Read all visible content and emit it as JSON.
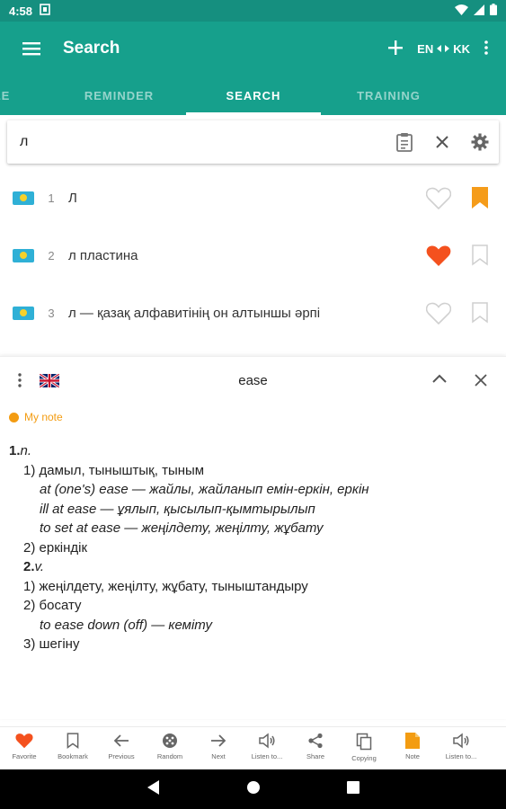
{
  "status": {
    "time": "4:58"
  },
  "appbar": {
    "title": "Search",
    "lang_from": "EN",
    "lang_to": "KK"
  },
  "tabs": [
    "LE",
    "REMINDER",
    "SEARCH",
    "TRAINING"
  ],
  "search": {
    "value": "л"
  },
  "results": [
    {
      "num": "1",
      "word": "Л",
      "favorite": false,
      "bookmarked": true
    },
    {
      "num": "2",
      "word": "л пластина",
      "favorite": true,
      "bookmarked": false
    },
    {
      "num": "3",
      "word": "л — қазақ алфавитінің он алтыншы әрпі",
      "favorite": false,
      "bookmarked": false
    }
  ],
  "panel": {
    "headword": "ease",
    "my_note": "My note",
    "article": {
      "pos1_num": "1.",
      "pos1": "n.",
      "s1": "1) дамыл, тыныштық, тыным",
      "ex1": "at (one's) ease — жайлы, жайланып емін-еркін, еркін",
      "ex2": "ill at ease — ұялып, қысылып-қымтырылып",
      "ex3": "to set at ease — жеңілдету, жеңілту, жұбату",
      "s2": "2) еркіндік",
      "pos2_num": "2.",
      "pos2": "v.",
      "v1": "1) жеңілдету, жеңілту, жұбату, тыныштандыру",
      "v2": "2) босату",
      "ex4": "to ease down (off) — кеміту",
      "v3": "3) шегіну"
    }
  },
  "bottombar": [
    {
      "label": "Favorite",
      "icon": "heart-icon"
    },
    {
      "label": "Bookmark",
      "icon": "bookmark-icon"
    },
    {
      "label": "Previous",
      "icon": "arrow-left-icon"
    },
    {
      "label": "Random",
      "icon": "dice-icon"
    },
    {
      "label": "Next",
      "icon": "arrow-right-icon"
    },
    {
      "label": "Listen to...",
      "icon": "speaker-icon"
    },
    {
      "label": "Share",
      "icon": "share-icon"
    },
    {
      "label": "Copying",
      "icon": "copy-icon"
    },
    {
      "label": "Note",
      "icon": "note-icon"
    },
    {
      "label": "Listen to...",
      "icon": "speaker-icon"
    }
  ],
  "colors": {
    "primary": "#16a08c",
    "status": "#158f7f",
    "accent": "#f4511e",
    "bookmark": "#f59c1a",
    "note": "#f39c12"
  }
}
